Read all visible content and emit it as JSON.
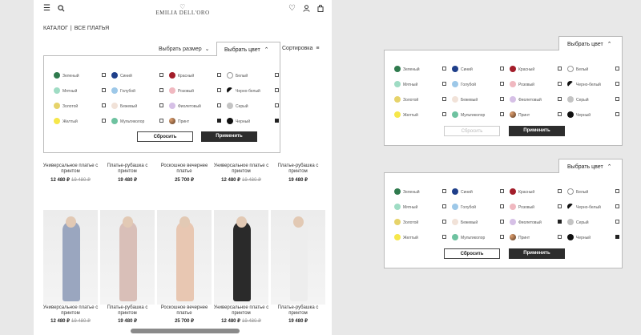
{
  "store": {
    "logo_text": "EMILIA DELL'ORO",
    "breadcrumb": {
      "catalog": "КАТАЛОГ",
      "separator": "|",
      "current": "ВСЕ ПЛАТЬЯ"
    },
    "filters": {
      "size_label": "Выбрать размер",
      "color_label": "Выбрать цвет",
      "sort_label": "Сортировка"
    },
    "products_row1": [
      {
        "title": "Универсальное платье с принтом",
        "price": "12 480 ₽",
        "old_price": "19 480 ₽"
      },
      {
        "title": "Платье-рубашка с принтом",
        "price": "19 480 ₽",
        "old_price": ""
      },
      {
        "title": "Роскошное вечернее платье",
        "price": "25 700 ₽",
        "old_price": ""
      },
      {
        "title": "Универсальное платье с принтом",
        "price": "12 480 ₽",
        "old_price": "19 480 ₽"
      },
      {
        "title": "Платье-рубашка с принтом",
        "price": "19 480 ₽",
        "old_price": ""
      }
    ],
    "products_row2": [
      {
        "title": "Универсальное платье с принтом",
        "price": "12 480 ₽",
        "old_price": "19 480 ₽",
        "dress": "#9aa6bf"
      },
      {
        "title": "Платье-рубашка с принтом",
        "price": "19 480 ₽",
        "old_price": "",
        "dress": "#d9bfb8"
      },
      {
        "title": "Роскошное вечернее платье",
        "price": "25 700 ₽",
        "old_price": "",
        "dress": "#e8c7b2"
      },
      {
        "title": "Универсальное платье с принтом",
        "price": "12 480 ₽",
        "old_price": "19 480 ₽",
        "dress": "#2a2a2a"
      },
      {
        "title": "Платье-рубашка с принтом",
        "price": "19 480 ₽",
        "old_price": "",
        "dress": "#ededed"
      }
    ]
  },
  "color_options": [
    {
      "label": "Зеленый",
      "color": "#2f7a4d"
    },
    {
      "label": "Синий",
      "color": "#1f3f8a"
    },
    {
      "label": "Красный",
      "color": "#a31d2a"
    },
    {
      "label": "Белый",
      "color": "#ffffff"
    },
    {
      "label": "Мятный",
      "color": "#9fdcc4"
    },
    {
      "label": "Голубой",
      "color": "#9dc8e8"
    },
    {
      "label": "Розовый",
      "color": "#f0b8c0"
    },
    {
      "label": "Черно-белый",
      "color": "#555555"
    },
    {
      "label": "Золотой",
      "color": "#e6d36a"
    },
    {
      "label": "Бежевый",
      "color": "#f1e2d8"
    },
    {
      "label": "Фиолетовый",
      "color": "#d6c0e6"
    },
    {
      "label": "Серый",
      "color": "#c4c4c4"
    },
    {
      "label": "Желтый",
      "color": "#f6e74a"
    },
    {
      "label": "Мультиколор",
      "color": "#6ec2a0"
    },
    {
      "label": "Принт",
      "color": "#b07a4a"
    },
    {
      "label": "Черный",
      "color": "#111111"
    }
  ],
  "panel_left": {
    "reset": "Сбросить",
    "apply": "Применить",
    "checked": [
      14,
      15
    ]
  },
  "panel_right_top": {
    "tab": "Выбрать цвет",
    "reset": "Сбросить",
    "apply": "Применить",
    "checked": []
  },
  "panel_right_bottom": {
    "tab": "Выбрать цвет",
    "reset": "Сбросить",
    "apply": "Применить",
    "checked": [
      10,
      15
    ]
  }
}
